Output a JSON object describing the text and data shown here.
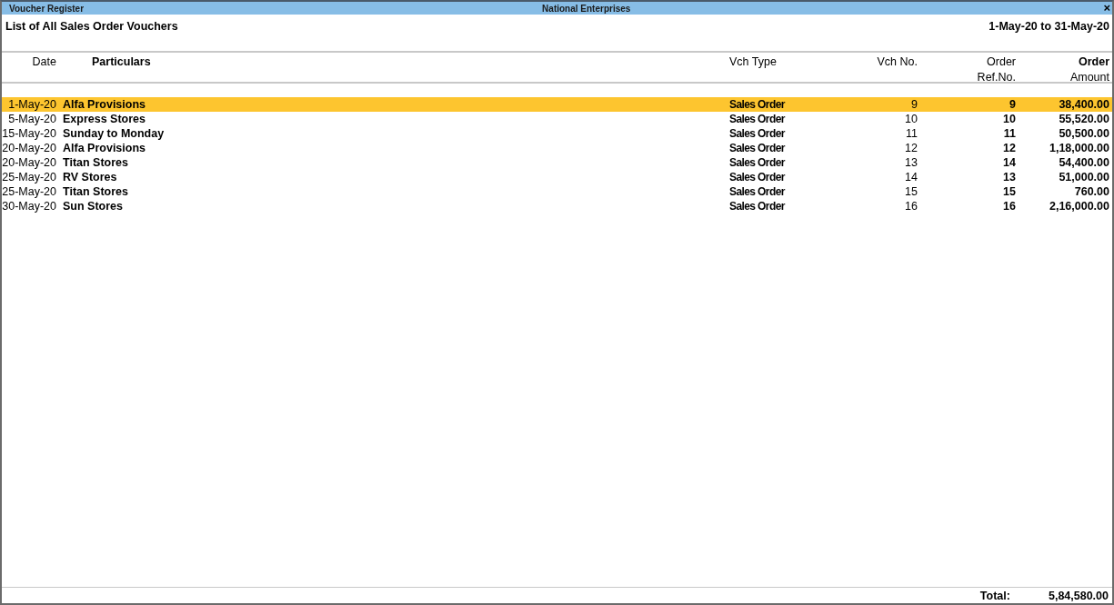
{
  "window": {
    "title": "Voucher Register",
    "company": "National Enterprises",
    "close": "×"
  },
  "report": {
    "title": "List of All Sales Order Vouchers",
    "period": "1-May-20 to 31-May-20"
  },
  "columns": [
    {
      "label": "Date"
    },
    {
      "label": "Particulars"
    },
    {
      "label": "Vch Type"
    },
    {
      "label": "Vch No."
    },
    {
      "label": "Order Ref.No."
    },
    {
      "label": "Order",
      "label_2": "Amount"
    }
  ],
  "rows": [
    {
      "date": "1-May-20",
      "particulars": "Alfa Provisions",
      "vch_type": "Sales Order",
      "vch_no": "9",
      "ref_no": "9",
      "amount": "38,400.00",
      "selected": true
    },
    {
      "date": "5-May-20",
      "particulars": "Express Stores",
      "vch_type": "Sales Order",
      "vch_no": "10",
      "ref_no": "10",
      "amount": "55,520.00",
      "selected": false
    },
    {
      "date": "15-May-20",
      "particulars": "Sunday to Monday",
      "vch_type": "Sales Order",
      "vch_no": "11",
      "ref_no": "11",
      "amount": "50,500.00",
      "selected": false
    },
    {
      "date": "20-May-20",
      "particulars": "Alfa Provisions",
      "vch_type": "Sales Order",
      "vch_no": "12",
      "ref_no": "12",
      "amount": "1,18,000.00",
      "selected": false
    },
    {
      "date": "20-May-20",
      "particulars": "Titan Stores",
      "vch_type": "Sales Order",
      "vch_no": "13",
      "ref_no": "14",
      "amount": "54,400.00",
      "selected": false
    },
    {
      "date": "25-May-20",
      "particulars": "RV Stores",
      "vch_type": "Sales Order",
      "vch_no": "14",
      "ref_no": "13",
      "amount": "51,000.00",
      "selected": false
    },
    {
      "date": "25-May-20",
      "particulars": "Titan Stores",
      "vch_type": "Sales Order",
      "vch_no": "15",
      "ref_no": "15",
      "amount": "760.00",
      "selected": false
    },
    {
      "date": "30-May-20",
      "particulars": "Sun Stores",
      "vch_type": "Sales Order",
      "vch_no": "16",
      "ref_no": "16",
      "amount": "2,16,000.00",
      "selected": false
    }
  ],
  "total": {
    "label": "Total:",
    "amount": "5,84,580.00"
  }
}
